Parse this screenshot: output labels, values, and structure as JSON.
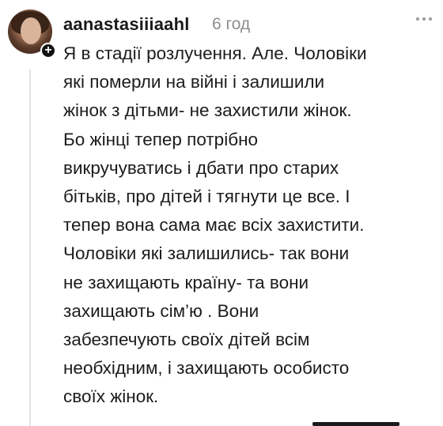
{
  "comment": {
    "author": "aanastasiiiaahl",
    "timestamp": "6 год",
    "lines": [
      "Я в стадії розлучення. Але. Чоловіки",
      "які померли на війні і залишили",
      "жінок з дітьми- не захистили жінок.",
      "Бо жінці тепер потрібно",
      "викручуватись і дбати про старих",
      "бітьків, про дітей і тягнути це все. І",
      "тепер вона сама має всіх захистити.",
      "Чоловіки які залишились- так вони",
      "не захищають країну- та вони",
      "захищають сім’ю . Вони",
      "забезпечують своїх дітей всім",
      "необхідним, і захищають особисто",
      "своїх жінок."
    ]
  },
  "icons": {
    "add_badge": "plus-icon",
    "more": "more-horizontal-icon"
  },
  "colors": {
    "username": "#1a1a1a",
    "timestamp": "#8d8d8d",
    "body_text": "#1c1c1c",
    "thread_line": "#e4e4e4"
  }
}
